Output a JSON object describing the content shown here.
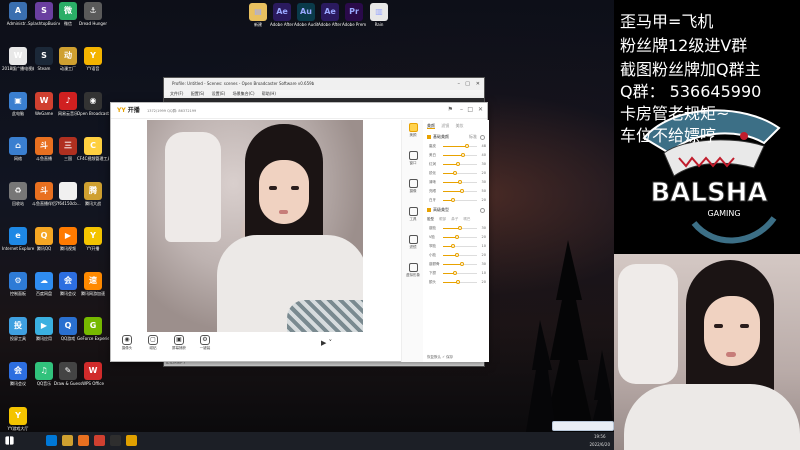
{
  "desktop": {
    "icons": [
      {
        "label": "Administr...",
        "color": "#3a6fb0",
        "glyph": "A"
      },
      {
        "label": "SplashtopBusiness",
        "color": "#6a3fa0",
        "glyph": "S"
      },
      {
        "label": "微信",
        "color": "#2aae67",
        "glyph": "微"
      },
      {
        "label": "Dread Hunger",
        "color": "#5a5a5a",
        "glyph": "⚓"
      },
      {
        "label": "2018版广播电视编导...",
        "color": "#e8e8e8",
        "glyph": "W"
      },
      {
        "label": "Steam",
        "color": "#1b2838",
        "glyph": "S"
      },
      {
        "label": "动漫工厂",
        "color": "#cfa030",
        "glyph": "动"
      },
      {
        "label": "YY语音",
        "color": "#f4b400",
        "glyph": "Y"
      },
      {
        "label": "此电脑",
        "color": "#3a7fd0",
        "glyph": "▣"
      },
      {
        "label": "WeGame",
        "color": "#d04030",
        "glyph": "W"
      },
      {
        "label": "网易云音乐",
        "color": "#d02020",
        "glyph": "♪"
      },
      {
        "label": "Open Broadcast...",
        "color": "#333",
        "glyph": "◉"
      },
      {
        "label": "网络",
        "color": "#3a7fd0",
        "glyph": "⌂"
      },
      {
        "label": "斗鱼直播",
        "color": "#e87020",
        "glyph": "斗"
      },
      {
        "label": "三国",
        "color": "#b03020",
        "glyph": "三"
      },
      {
        "label": "CF4C视频管理工具",
        "color": "#ffd040",
        "glyph": "C"
      },
      {
        "label": "回收站",
        "color": "#777",
        "glyph": "♻"
      },
      {
        "label": "斗鱼直播伴侣",
        "color": "#e87020",
        "glyph": "斗"
      },
      {
        "label": "7f64150cb...",
        "color": "#f0f0f0",
        "glyph": ""
      },
      {
        "label": "腾讯大战",
        "color": "#cfa030",
        "glyph": "腾"
      },
      {
        "label": "Internet Explorer",
        "color": "#1e88e5",
        "glyph": "e"
      },
      {
        "label": "腾讯QQ",
        "color": "#f5a623",
        "glyph": "Q"
      },
      {
        "label": "腾讯视频",
        "color": "#ff7a00",
        "glyph": "▶"
      },
      {
        "label": "YY开播",
        "color": "#f4c400",
        "glyph": "Y"
      },
      {
        "label": "控制面板",
        "color": "#2e7bd6",
        "glyph": "⚙"
      },
      {
        "label": "百度网盘",
        "color": "#2f8cf0",
        "glyph": "☁"
      },
      {
        "label": "腾讯会议",
        "color": "#2d6ee0",
        "glyph": "会"
      },
      {
        "label": "腾讯网游加速",
        "color": "#ff8a00",
        "glyph": "速"
      },
      {
        "label": "投屏工具",
        "color": "#3fa0e0",
        "glyph": "投"
      },
      {
        "label": "腾讯应用",
        "color": "#3ab0e0",
        "glyph": "▶"
      },
      {
        "label": "QQ游戏",
        "color": "#2a70d0",
        "glyph": "Q"
      },
      {
        "label": "GeForce Experience",
        "color": "#76b900",
        "glyph": "G"
      },
      {
        "label": "腾讯会议",
        "color": "#2d6ee0",
        "glyph": "会"
      },
      {
        "label": "QQ音乐",
        "color": "#31c27c",
        "glyph": "♫"
      },
      {
        "label": "Draw & Guess",
        "color": "#444",
        "glyph": "✎"
      },
      {
        "label": "WPS Office",
        "color": "#d02b2b",
        "glyph": "W"
      },
      {
        "label": "YY游戏大厅",
        "color": "#f4c400",
        "glyph": "Y"
      }
    ],
    "top_icons": [
      {
        "label": "新建",
        "color": "#e8c060",
        "glyph": "▤"
      },
      {
        "label": "Adobe After Effects CC ...",
        "color": "#2a1a5e",
        "glyph": "Ae"
      },
      {
        "label": "Adobe Audit...",
        "color": "#0a3a4a",
        "glyph": "Au"
      },
      {
        "label": "Adobe After Effects CC ...",
        "color": "#2a1a5e",
        "glyph": "Ae"
      },
      {
        "label": "Adobe Premie...",
        "color": "#2a0a4a",
        "glyph": "Pr"
      },
      {
        "label": "Rain",
        "color": "#e8e8e8",
        "glyph": "▥"
      }
    ]
  },
  "obs_window": {
    "title": "Profile: Untitled - Scenes: scenes - Open Broadcaster Software v0.659b",
    "menu": [
      "文件(F)",
      "配置(S)",
      "设置(E)",
      "场景集合(C)",
      "帮助(H)"
    ],
    "status": "正在预览(P)"
  },
  "yy_window": {
    "logo_left": "YY",
    "logo_right": "开播",
    "room_id": "1372/1999  QQ群: 86372199",
    "toolbar": [
      {
        "label": "摄像头",
        "glyph": "◉"
      },
      {
        "label": "磁贴",
        "glyph": "▢"
      },
      {
        "label": "屏幕捕获",
        "glyph": "▣"
      },
      {
        "label": "一键装",
        "glyph": "⚙"
      }
    ],
    "side_nav": [
      {
        "label": "美颜",
        "active": true
      },
      {
        "label": "窗口",
        "active": false
      },
      {
        "label": "摄像",
        "active": false
      },
      {
        "label": "工具",
        "active": false
      },
      {
        "label": "滤镜",
        "active": false
      },
      {
        "label": "虚拟形象",
        "active": false
      }
    ],
    "panel": {
      "tabs": [
        "美颜",
        "滤镜",
        "美妆"
      ],
      "section1": {
        "title": "基础美颜",
        "preset": "标准"
      },
      "sliders1": [
        {
          "name": "磨皮",
          "value": 48,
          "pct": 0.7
        },
        {
          "name": "美白",
          "value": 40,
          "pct": 0.6
        },
        {
          "name": "红润",
          "value": 30,
          "pct": 0.45
        },
        {
          "name": "锐化",
          "value": 20,
          "pct": 0.35
        },
        {
          "name": "清晰",
          "value": 30,
          "pct": 0.5
        },
        {
          "name": "亮眼",
          "value": 50,
          "pct": 0.55
        },
        {
          "name": "白牙",
          "value": 20,
          "pct": 0.3
        }
      ],
      "section2": {
        "title": "高级美型"
      },
      "subtabs": [
        "脸型",
        "眼部",
        "鼻子",
        "嘴巴"
      ],
      "sliders2": [
        {
          "name": "瘦脸",
          "value": 30,
          "pct": 0.5
        },
        {
          "name": "V脸",
          "value": 20,
          "pct": 0.4
        },
        {
          "name": "窄脸",
          "value": 10,
          "pct": 0.3
        },
        {
          "name": "小脸",
          "value": 20,
          "pct": 0.4
        },
        {
          "name": "瘦颧骨",
          "value": 30,
          "pct": 0.55
        },
        {
          "name": "下颌",
          "value": 10,
          "pct": 0.35
        },
        {
          "name": "额头",
          "value": 20,
          "pct": 0.45
        }
      ],
      "footer": "恢复默认 ✓ 保存"
    }
  },
  "taskbar": {
    "icons": [
      "#0078d7",
      "#cfa030",
      "#e87020",
      "#d04030",
      "#2e2e2e",
      "#e0a000"
    ],
    "time": "19:56",
    "date": "2022/6/20"
  },
  "overlay": {
    "lines": [
      "歪马甲=飞机",
      "粉丝牌12级进V群",
      "截图粉丝牌加Q群主",
      "Q群： 536645990",
      "卡房管老规矩~",
      "车位不给嫖哼"
    ],
    "logo_text": "BALSHA",
    "logo_sub": "GAMING"
  }
}
